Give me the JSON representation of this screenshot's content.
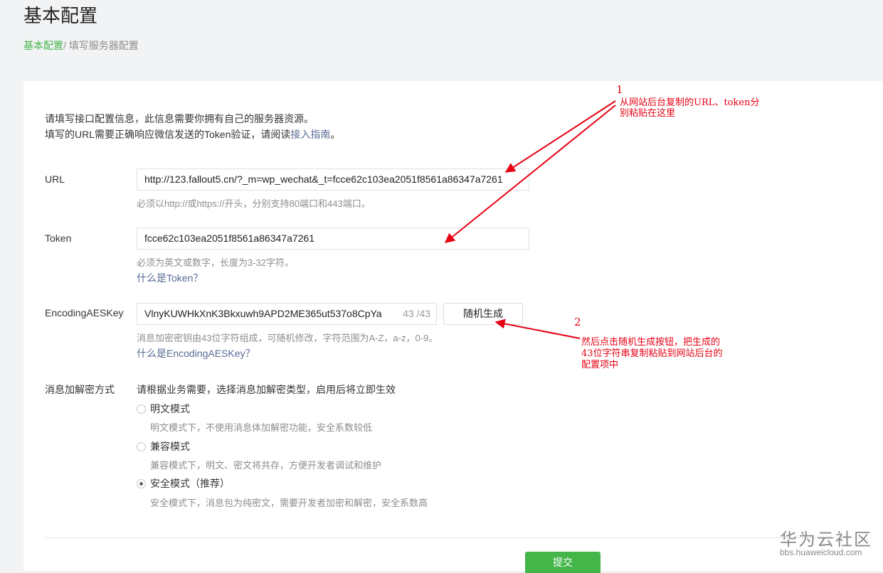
{
  "header": {
    "title": "基本配置",
    "breadcrumb_link": "基本配置",
    "breadcrumb_sep": "/",
    "breadcrumb_current": "填写服务器配置"
  },
  "intro": {
    "line1": "请填写接口配置信息，此信息需要你拥有自己的服务器资源。",
    "line2_prefix": "填写的URL需要正确响应微信发送的Token验证，请阅读",
    "line2_link": "接入指南",
    "line2_suffix": "。"
  },
  "url": {
    "label": "URL",
    "value": "http://123.fallout5.cn/?_m=wp_wechat&_t=fcce62c103ea2051f8561a86347a7261",
    "tip": "必须以http://或https://开头，分别支持80端口和443端口。"
  },
  "token": {
    "label": "Token",
    "value": "fcce62c103ea2051f8561a86347a7261",
    "tip": "必须为英文或数字，长度为3-32字符。",
    "help_link": "什么是Token？"
  },
  "aes": {
    "label": "EncodingAESKey",
    "value": "VlnyKUWHkXnK3Bkxuwh9APD2ME365ut537o8CpYa",
    "counter": "43 /43",
    "generate_label": "随机生成",
    "tip": "消息加密密钥由43位字符组成，可随机修改，字符范围为A-Z，a-z，0-9。",
    "help_link": "什么是EncodingAESKey？"
  },
  "encryption": {
    "label": "消息加解密方式",
    "hint": "请根据业务需要，选择消息加解密类型，启用后将立即生效",
    "options": [
      {
        "label": "明文模式",
        "desc": "明文模式下，不使用消息体加解密功能，安全系数较低",
        "checked": false
      },
      {
        "label": "兼容模式",
        "desc": "兼容模式下，明文、密文将共存，方便开发者调试和维护",
        "checked": false
      },
      {
        "label": "安全模式（推荐）",
        "desc": "安全模式下，消息包为纯密文，需要开发者加密和解密，安全系数高",
        "checked": true
      }
    ]
  },
  "submit_label": "提交",
  "annotations": {
    "num1": "1",
    "note1_line1": "从网站后台复制的URL、token分",
    "note1_line2": "别粘贴在这里",
    "num2": "2",
    "note2_line1": "然后点击随机生成按钮，把生成的",
    "note2_line2": "43位字符串复制粘贴到网站后台的",
    "note2_line3": "配置项中",
    "color": "#e60012"
  },
  "watermark": {
    "logo": "华为云社区",
    "url": "bbs.huaweicloud.com"
  },
  "colors": {
    "accent_green": "#44b549",
    "link_blue": "#576b95",
    "annotation_red": "#e60012"
  }
}
